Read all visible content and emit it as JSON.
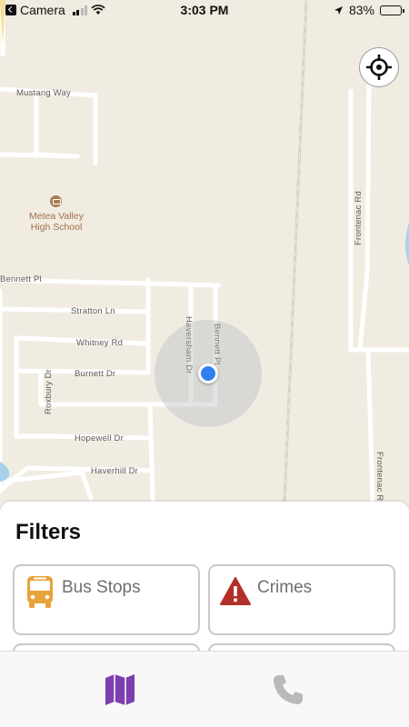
{
  "status_bar": {
    "back_app": "Camera",
    "time": "3:03 PM",
    "battery": "83%",
    "battery_level": 0.83
  },
  "map": {
    "street_labels": {
      "mustang_way": "Mustang Way",
      "bennett_pl_west": "Bennett Pl",
      "stratton_ln": "Stratton Ln",
      "whitney_rd": "Whitney Rd",
      "burnett_dr": "Burnett Dr",
      "hopewell_dr": "Hopewell Dr",
      "haverhill_dr": "Haverhill Dr",
      "roxbury_dr": "Roxbury Dr",
      "haversham_dr": "Haversham Dr",
      "bennett_pl_east": "Bennett Pl",
      "frontenac_rd_north": "Frontenac Rd",
      "frontenac_rd_south": "Frontenac Rd"
    },
    "poi": {
      "school_name": "Metea Valley High School",
      "icon": "school-icon"
    },
    "locate_button_icon": "crosshair-icon"
  },
  "filters": {
    "title": "Filters",
    "items": [
      {
        "label": "Bus Stops",
        "icon": "bus-icon",
        "color": "#e8a23a"
      },
      {
        "label": "Crimes",
        "icon": "warning-icon",
        "color": "#b3302a"
      }
    ]
  },
  "tabbar": {
    "tabs": [
      {
        "icon": "map-icon",
        "active": true,
        "color": "#7b3fb0"
      },
      {
        "icon": "phone-icon",
        "active": false,
        "color": "#b9b9b9"
      }
    ]
  }
}
